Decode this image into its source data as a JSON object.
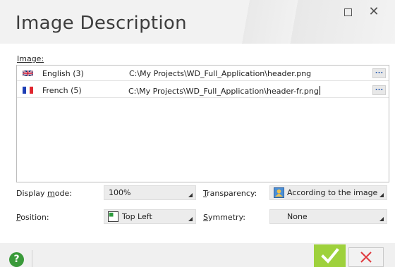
{
  "window": {
    "title": "Image Description",
    "maximize_icon": "maximize-icon",
    "close_glyph": "✕"
  },
  "image_section": {
    "label": "Image:",
    "rows": [
      {
        "flag": "uk-flag-icon",
        "language": "English (3)",
        "path": "C:\\My Projects\\WD_Full_Application\\header.png",
        "button": "..."
      },
      {
        "flag": "france-flag-icon",
        "language": "French (5)",
        "path": "C:\\My Projects\\WD_Full_Application\\header-fr.png",
        "button": "..."
      }
    ]
  },
  "display_mode": {
    "label_pre": "Display ",
    "label_u": "m",
    "label_post": "ode:",
    "value": "100%"
  },
  "transparency": {
    "label_pre": "",
    "label_u": "T",
    "label_post": "ransparency:",
    "value": "According to the image",
    "icon": "transparency-icon"
  },
  "position": {
    "label_pre": "",
    "label_u": "P",
    "label_post": "osition:",
    "value": "Top Left",
    "icon": "top-left-icon"
  },
  "symmetry": {
    "label_pre": "",
    "label_u": "S",
    "label_post": "ymmetry:",
    "value": "None"
  },
  "footer": {
    "help_glyph": "?",
    "ok_icon": "checkmark-icon",
    "cancel_icon": "cross-icon"
  },
  "colors": {
    "ok_green": "#9ed13c",
    "help_green": "#3a9a3a",
    "cancel_red": "#e0393e"
  }
}
